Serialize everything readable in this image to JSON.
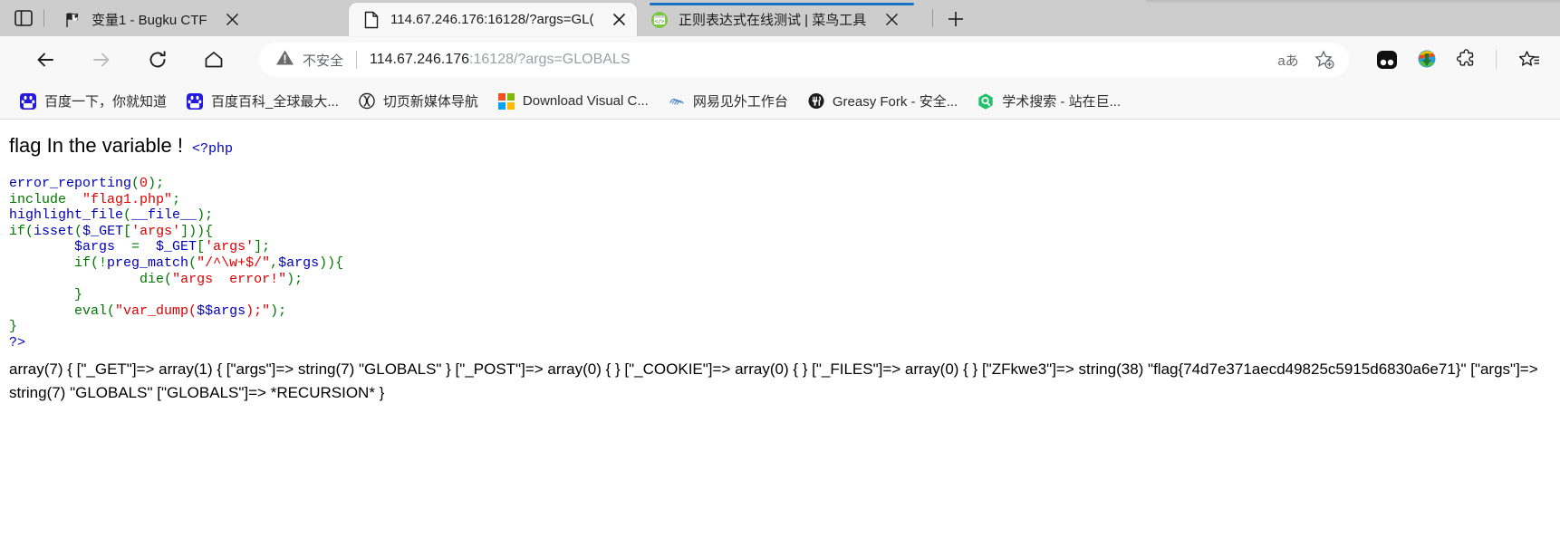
{
  "browser": {
    "tabstrip": {
      "sidebar_toggle_icon": "sidebar-panel-icon",
      "new_tab_icon": "plus-icon",
      "tabs": [
        {
          "title": "变量1 - Bugku CTF",
          "favicon": "checkered-flag-icon",
          "active": false,
          "close_label": "×"
        },
        {
          "title": "114.67.246.176:16128/?args=GL(",
          "favicon": "blank-page-icon",
          "active": true,
          "close_label": "×"
        },
        {
          "title": "正则表达式在线测试 | 菜鸟工具",
          "favicon": "code-window-icon",
          "active": false,
          "close_label": "×"
        }
      ]
    },
    "toolbar": {
      "back_icon": "arrow-left-icon",
      "forward_icon": "arrow-right-icon",
      "reload_icon": "reload-icon",
      "home_icon": "home-icon",
      "security_label": "不安全",
      "security_icon": "warning-triangle-icon",
      "url_host": "114.67.246.176",
      "url_rest": ":16128/?args=GLOBALS",
      "translate_label": "aあ",
      "translate_icon": "translate-icon",
      "bookmark_icon": "star-plus-icon",
      "extensions": [
        {
          "name": "bitwarden-icon"
        },
        {
          "name": "internet-download-manager-icon"
        },
        {
          "name": "extensions-puzzle-icon"
        },
        {
          "name": "collections-star-icon"
        }
      ]
    },
    "bookmarks": [
      {
        "label": "百度一下，你就知道",
        "icon": "baidu-paw-icon"
      },
      {
        "label": "百度百科_全球最大...",
        "icon": "baidu-paw-icon"
      },
      {
        "label": "切页新媒体导航",
        "icon": "qieye-circle-icon"
      },
      {
        "label": "Download Visual C...",
        "icon": "microsoft-squares-icon"
      },
      {
        "label": "网易见外工作台",
        "icon": "netease-fan-icon"
      },
      {
        "label": "Greasy Fork - 安全...",
        "icon": "greasyfork-circle-icon"
      },
      {
        "label": "学术搜索 - 站在巨...",
        "icon": "scholar-hex-icon"
      }
    ]
  },
  "page": {
    "heading": "flag In the variable !",
    "php_open": "<?php",
    "php_close": "?>",
    "code_lines": [
      [
        {
          "t": "error_reporting",
          "c": "c-fn"
        },
        {
          "t": "(",
          "c": "c-kw"
        },
        {
          "t": "0",
          "c": "c-str"
        },
        {
          "t": ");",
          "c": "c-kw"
        }
      ],
      [
        {
          "t": "include",
          "c": "c-kw"
        },
        {
          "t": "  ",
          "c": "c-kw"
        },
        {
          "t": "\"flag1.php\"",
          "c": "c-str"
        },
        {
          "t": ";",
          "c": "c-kw"
        }
      ],
      [
        {
          "t": "highlight_file",
          "c": "c-fn"
        },
        {
          "t": "(",
          "c": "c-kw"
        },
        {
          "t": "__file__",
          "c": "c-fn"
        },
        {
          "t": ");",
          "c": "c-kw"
        }
      ],
      [
        {
          "t": "if",
          "c": "c-kw"
        },
        {
          "t": "(",
          "c": "c-kw"
        },
        {
          "t": "isset",
          "c": "c-fn"
        },
        {
          "t": "(",
          "c": "c-kw"
        },
        {
          "t": "$_GET",
          "c": "c-var"
        },
        {
          "t": "[",
          "c": "c-kw"
        },
        {
          "t": "'args'",
          "c": "c-str"
        },
        {
          "t": "])){",
          "c": "c-kw"
        }
      ],
      [
        {
          "t": "        ",
          "c": "c-kw"
        },
        {
          "t": "$args",
          "c": "c-var"
        },
        {
          "t": "  =  ",
          "c": "c-kw"
        },
        {
          "t": "$_GET",
          "c": "c-var"
        },
        {
          "t": "[",
          "c": "c-kw"
        },
        {
          "t": "'args'",
          "c": "c-str"
        },
        {
          "t": "];",
          "c": "c-kw"
        }
      ],
      [
        {
          "t": "        ",
          "c": "c-kw"
        },
        {
          "t": "if",
          "c": "c-kw"
        },
        {
          "t": "(!",
          "c": "c-kw"
        },
        {
          "t": "preg_match",
          "c": "c-fn"
        },
        {
          "t": "(",
          "c": "c-kw"
        },
        {
          "t": "\"/^\\w+$/\"",
          "c": "c-str"
        },
        {
          "t": ",",
          "c": "c-kw"
        },
        {
          "t": "$args",
          "c": "c-var"
        },
        {
          "t": ")){",
          "c": "c-kw"
        }
      ],
      [
        {
          "t": "                ",
          "c": "c-kw"
        },
        {
          "t": "die",
          "c": "c-kw"
        },
        {
          "t": "(",
          "c": "c-kw"
        },
        {
          "t": "\"args  error!\"",
          "c": "c-str"
        },
        {
          "t": ");",
          "c": "c-kw"
        }
      ],
      [
        {
          "t": "        }",
          "c": "c-kw"
        }
      ],
      [
        {
          "t": "        ",
          "c": "c-kw"
        },
        {
          "t": "eval",
          "c": "c-kw"
        },
        {
          "t": "(",
          "c": "c-kw"
        },
        {
          "t": "\"var_dump(",
          "c": "c-str"
        },
        {
          "t": "$$args",
          "c": "c-var"
        },
        {
          "t": ");\"",
          "c": "c-str"
        },
        {
          "t": ");",
          "c": "c-kw"
        }
      ],
      [
        {
          "t": "}",
          "c": "c-kw"
        }
      ]
    ],
    "var_dump_output": "array(7) { [\"_GET\"]=> array(1) { [\"args\"]=> string(7) \"GLOBALS\" } [\"_POST\"]=> array(0) { } [\"_COOKIE\"]=> array(0) { } [\"_FILES\"]=> array(0) { } [\"ZFkwe3\"]=> string(38) \"flag{74d7e371aecd49825c5915d6830a6e71}\" [\"args\"]=> string(7) \"GLOBALS\" [\"GLOBALS\"]=> *RECURSION* }"
  },
  "colors": {
    "php_function": "#0000BB",
    "php_keyword": "#007700",
    "php_string": "#DD0000",
    "active_tab_indicator": "#1a73c8",
    "chrome_bg": "#cdcdcd",
    "toolbar_bg": "#f8f8f8"
  }
}
